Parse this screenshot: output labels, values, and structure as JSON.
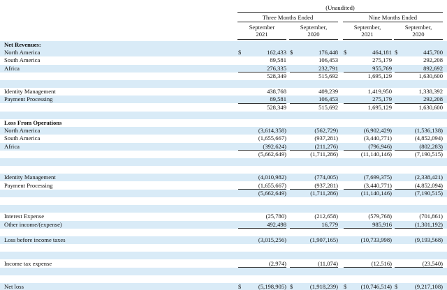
{
  "header": {
    "unaudited": "(Unaudited)",
    "group_three": "Three Months Ended",
    "group_nine": "Nine Months Ended",
    "columns": [
      {
        "line1": "September",
        "line2": "2021"
      },
      {
        "line1": "September,",
        "line2": "2020"
      },
      {
        "line1": "September,",
        "line2": "2021"
      },
      {
        "line1": "September,",
        "line2": "2020"
      }
    ]
  },
  "rows": [
    {
      "label": "Net Revenues:",
      "bold": true,
      "shade": true,
      "values": []
    },
    {
      "label": "North America",
      "shade": true,
      "dollar": true,
      "values": [
        "162,433",
        "176,448",
        "464,181",
        "445,700"
      ]
    },
    {
      "label": "South America",
      "values": [
        "89,581",
        "106,453",
        "275,179",
        "292,208"
      ]
    },
    {
      "label": "Africa",
      "shade": true,
      "values": [
        "276,335",
        "232,791",
        "955,769",
        "892,692"
      ],
      "underline": true
    },
    {
      "label": "",
      "values": [
        "528,349",
        "515,692",
        "1,695,129",
        "1,630,600"
      ]
    },
    {
      "label": "",
      "shade": true,
      "values": []
    },
    {
      "label": "Identity Management",
      "values": [
        "438,768",
        "409,239",
        "1,419,950",
        "1,338,392"
      ]
    },
    {
      "label": "Payment Processing",
      "shade": true,
      "values": [
        "89,581",
        "106,453",
        "275,179",
        "292,208"
      ],
      "underline": true
    },
    {
      "label": "",
      "values": [
        "528,349",
        "515,692",
        "1,695,129",
        "1,630,600"
      ]
    },
    {
      "label": "",
      "shade": true,
      "values": []
    },
    {
      "label": "Loss From Operations",
      "bold": true,
      "values": []
    },
    {
      "label": "North America",
      "shade": true,
      "values": [
        "(3,614,358)",
        "(562,729)",
        "(6,902,429)",
        "(1,536,138)"
      ]
    },
    {
      "label": "South America",
      "values": [
        "(1,655,667)",
        "(937,281)",
        "(3,440,771)",
        "(4,852,094)"
      ]
    },
    {
      "label": "Africa",
      "shade": true,
      "values": [
        "(392,624)",
        "(211,276)",
        "(796,946)",
        "(802,283)"
      ],
      "underline": true
    },
    {
      "label": "",
      "values": [
        "(5,662,649)",
        "(1,711,286)",
        "(11,140,146)",
        "(7,190,515)"
      ]
    },
    {
      "label": "",
      "shade": true,
      "values": []
    },
    {
      "label": "",
      "values": []
    },
    {
      "label": "Identity Management",
      "shade": true,
      "values": [
        "(4,010,982)",
        "(774,005)",
        "(7,699,375)",
        "(2,338,421)"
      ]
    },
    {
      "label": "Payment Processing",
      "values": [
        "(1,655,667)",
        "(937,281)",
        "(3,440,771)",
        "(4,852,094)"
      ],
      "underline": true
    },
    {
      "label": "",
      "shade": true,
      "values": [
        "(5,662,649)",
        "(1,711,286)",
        "(11,140,146)",
        "(7,190,515)"
      ]
    },
    {
      "label": "",
      "values": []
    },
    {
      "label": "",
      "shade": true,
      "values": []
    },
    {
      "label": "Interest Expense",
      "values": [
        "(25,780)",
        "(212,658)",
        "(579,768)",
        "(701,861)"
      ]
    },
    {
      "label": "Other income/(expense)",
      "shade": true,
      "values": [
        "492,498",
        "16,779",
        "985,916",
        "(1,301,192)"
      ],
      "underline": true
    },
    {
      "label": "",
      "values": []
    },
    {
      "label": "Loss before income taxes",
      "shade": true,
      "values": [
        "(3,015,256)",
        "(1,907,165)",
        "(10,733,998)",
        "(9,193,568)"
      ]
    },
    {
      "label": "",
      "values": []
    },
    {
      "label": "",
      "shade": true,
      "values": []
    },
    {
      "label": "Income tax expense",
      "values": [
        "(2,974)",
        "(11,074)",
        "(12,516)",
        "(23,540)"
      ],
      "underline": true
    },
    {
      "label": "",
      "shade": true,
      "values": []
    },
    {
      "label": "",
      "values": []
    },
    {
      "label": "Net loss",
      "shade": true,
      "dollar": true,
      "values": [
        "(5,198,905)",
        "(1,918,239)",
        "(10,746,514)",
        "(9,217,108)"
      ],
      "double": true
    }
  ],
  "dollar_sign": "$"
}
